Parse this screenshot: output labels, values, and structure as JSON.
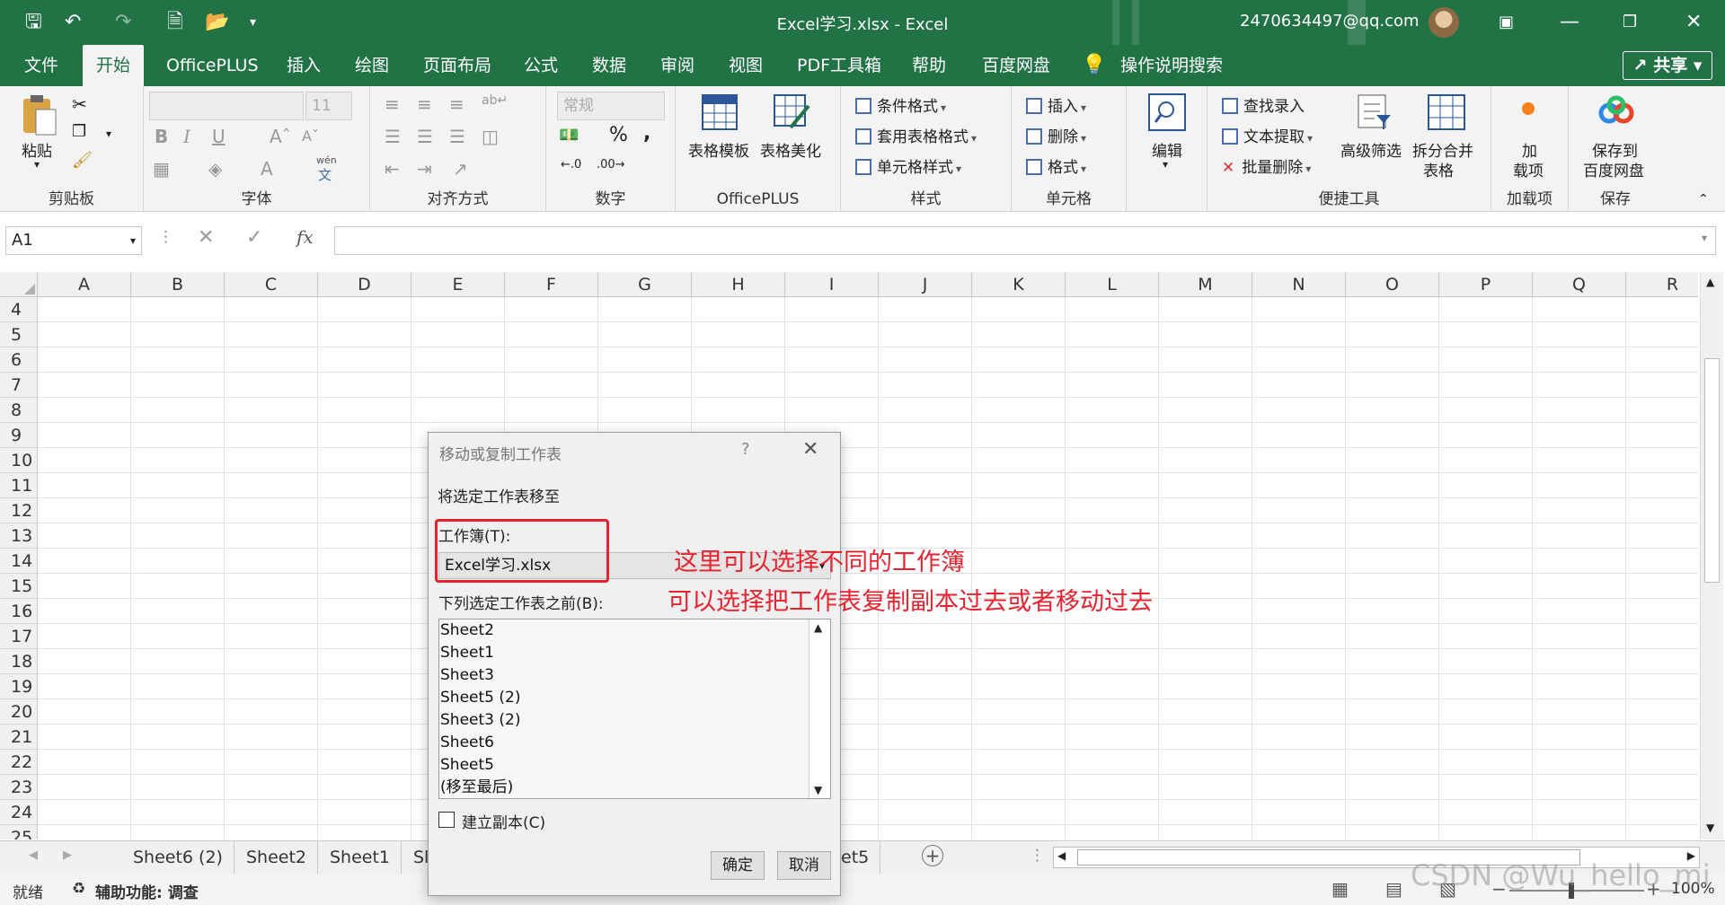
{
  "titlebar": {
    "title": "Excel学习.xlsx  -  Excel",
    "account": "2470634497@qq.com"
  },
  "tabs": [
    "文件",
    "开始",
    "OfficePLUS",
    "插入",
    "绘图",
    "页面布局",
    "公式",
    "数据",
    "审阅",
    "视图",
    "PDF工具箱",
    "帮助",
    "百度网盘",
    "操作说明搜索"
  ],
  "share_label": "共享",
  "ribbon": {
    "clipboard": {
      "paste": "粘贴",
      "label": "剪贴板"
    },
    "font": {
      "size": "11",
      "label": "字体",
      "bold": "B",
      "italic": "I",
      "underline": "U",
      "wen": "wén",
      "wenzi": "文"
    },
    "alignment": {
      "label": "对齐方式"
    },
    "number": {
      "format": "常规",
      "label": "数字",
      "percent": "%"
    },
    "officeplus": {
      "btn1": "表格模板",
      "btn2": "表格美化",
      "label": "OfficePLUS"
    },
    "styles": {
      "cond": "条件格式",
      "table": "套用表格格式",
      "cell": "单元格样式",
      "label": "样式"
    },
    "cells": {
      "insert": "插入",
      "delete": "删除",
      "format": "格式",
      "label": "单元格"
    },
    "editing": {
      "btn": "编辑"
    },
    "tools": {
      "find": "查找录入",
      "extract": "文本提取",
      "batch": "批量删除",
      "filter": "高级筛选",
      "split": "拆分合并",
      "split2": "表格",
      "label": "便捷工具"
    },
    "addins": {
      "btn": "加",
      "btn2": "载项",
      "label": "加载项"
    },
    "save": {
      "btn": "保存到",
      "btn2": "百度网盘",
      "label": "保存"
    }
  },
  "formula_bar": {
    "namebox": "A1",
    "fx": "fx",
    "value": ""
  },
  "columns": [
    "A",
    "B",
    "C",
    "D",
    "E",
    "F",
    "G",
    "H",
    "I",
    "J",
    "K",
    "L",
    "M",
    "N",
    "O",
    "P",
    "Q",
    "R"
  ],
  "rows": [
    "4",
    "5",
    "6",
    "7",
    "8",
    "9",
    "10",
    "11",
    "12",
    "13",
    "14",
    "15",
    "16",
    "17",
    "18",
    "19",
    "20",
    "21",
    "22",
    "23",
    "24",
    "25"
  ],
  "sheet_tabs": [
    "Sheet6 (2)",
    "Sheet2",
    "Sheet1",
    "Sl",
    "et5"
  ],
  "status": {
    "ready": "就绪",
    "accessibility": "辅助功能: 调查",
    "zoom": "100%"
  },
  "dialog": {
    "title": "移动或复制工作表",
    "help": "?",
    "move_to": "将选定工作表移至",
    "workbook_label": "工作簿(T):",
    "workbook_value": "Excel学习.xlsx",
    "before_label": "下列选定工作表之前(B):",
    "sheets": [
      "Sheet2",
      "Sheet1",
      "Sheet3",
      "Sheet5 (2)",
      "Sheet3 (2)",
      "Sheet6",
      "Sheet5",
      "(移至最后)"
    ],
    "copy_label": "建立副本(C)",
    "ok": "确定",
    "cancel": "取消"
  },
  "annotations": {
    "line1": "这里可以选择不同的工作簿",
    "line2": "可以选择把工作表复制副本过去或者移动过去"
  },
  "watermark": "CSDN @Wu_hello_mi",
  "colors": {
    "excel_green": "#217346",
    "annotation_red": "#e8232f"
  }
}
